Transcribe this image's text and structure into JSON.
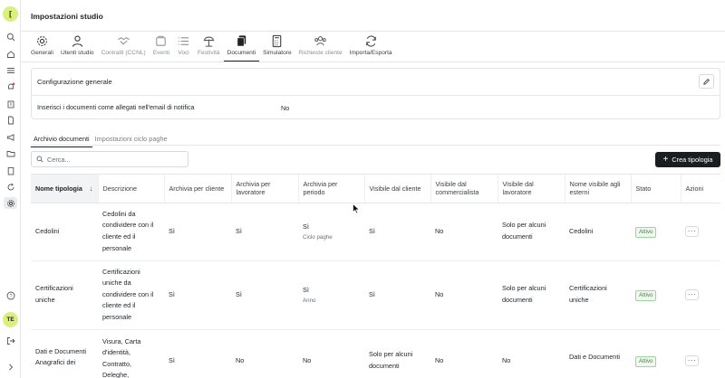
{
  "app": {
    "logo_letter": "[",
    "avatar_initials": "TE"
  },
  "header": {
    "title": "Impostazioni studio"
  },
  "tabs": [
    {
      "label": "Generali",
      "icon": "gear-icon"
    },
    {
      "label": "Utenti studio",
      "icon": "user-icon"
    },
    {
      "label": "Contratti (CCNL)",
      "icon": "handshake-icon"
    },
    {
      "label": "Eventi",
      "icon": "calendar-stack-icon"
    },
    {
      "label": "Voci",
      "icon": "list-icon"
    },
    {
      "label": "Festività",
      "icon": "beach-umbrella-icon"
    },
    {
      "label": "Documenti",
      "icon": "documents-icon"
    },
    {
      "label": "Simulatore",
      "icon": "calculator-icon"
    },
    {
      "label": "Richieste cliente",
      "icon": "users-group-icon"
    },
    {
      "label": "Importa/Esporta",
      "icon": "sync-icon"
    }
  ],
  "config": {
    "title": "Configurazione generale",
    "row_label": "Inserisci i documenti come allegati nell'email di notifica",
    "row_value": "No"
  },
  "subtabs": [
    "Archivio documenti",
    "Impostazioni ciclo paghe"
  ],
  "search": {
    "placeholder": "Cerca..."
  },
  "create_button": "Crea tipologia",
  "table": {
    "columns": [
      "Nome tipologia",
      "Descrizione",
      "Archivia per cliente",
      "Archivia per lavoratore",
      "Archivia per periodo",
      "Visibile dal cliente",
      "Visibile dal commercialista",
      "Visibile dal lavoratore",
      "Nome visibile agli esterni",
      "Stato",
      "Azioni"
    ],
    "rows": [
      {
        "name": "Cedolini",
        "description": "Cedolini da condividere con il cliente ed il personale",
        "per_cliente": "Sì",
        "per_lavoratore": "Sì",
        "per_periodo": "Sì",
        "periodo_sub": "Ciclo paghe",
        "vis_cliente": "Sì",
        "vis_commercialista": "No",
        "vis_lavoratore": "Solo per alcuni documenti",
        "nome_esterni": "Cedolini",
        "stato": "Attivo"
      },
      {
        "name": "Certificazioni uniche",
        "description": "Certificazioni uniche da condividere con il cliente ed il personale",
        "per_cliente": "Sì",
        "per_lavoratore": "Sì",
        "per_periodo": "Sì",
        "periodo_sub": "Anno",
        "vis_cliente": "Sì",
        "vis_commercialista": "No",
        "vis_lavoratore": "Solo per alcuni documenti",
        "nome_esterni": "Certificazioni uniche",
        "stato": "Attivo"
      },
      {
        "name": "Dati e Documenti Anagrafici dei",
        "description": "Visura, Carta d'identità, Contratto, Deleghe,",
        "per_cliente": "Sì",
        "per_lavoratore": "No",
        "per_periodo": "No",
        "periodo_sub": "",
        "vis_cliente": "Solo per alcuni documenti",
        "vis_commercialista": "No",
        "vis_lavoratore": "No",
        "nome_esterni": "Dati e Documenti",
        "stato": "Attivo"
      }
    ],
    "more_label": "···"
  }
}
